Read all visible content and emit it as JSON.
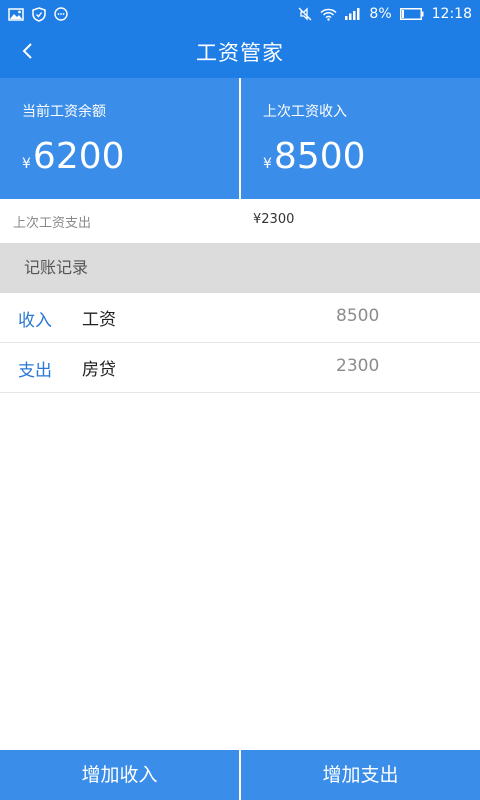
{
  "status_bar": {
    "battery": "8%",
    "time": "12:18"
  },
  "header": {
    "title": "工资管家",
    "back_icon": "chevron-left-icon"
  },
  "summary": {
    "currency_symbol": "¥",
    "balance": {
      "label": "当前工资余额",
      "value": "6200"
    },
    "last_income": {
      "label": "上次工资收入",
      "value": "8500"
    }
  },
  "last_expense": {
    "label": "上次工资支出",
    "value": "¥2300"
  },
  "records": {
    "title": "记账记录",
    "items": [
      {
        "type": "收入",
        "name": "工资",
        "amount": "8500"
      },
      {
        "type": "支出",
        "name": "房贷",
        "amount": "2300"
      }
    ]
  },
  "actions": {
    "add_income": "增加收入",
    "add_expense": "增加支出"
  },
  "colors": {
    "primary": "#1e7ee6",
    "card_background": "#3a8de8",
    "type_text": "#2a78d6"
  }
}
